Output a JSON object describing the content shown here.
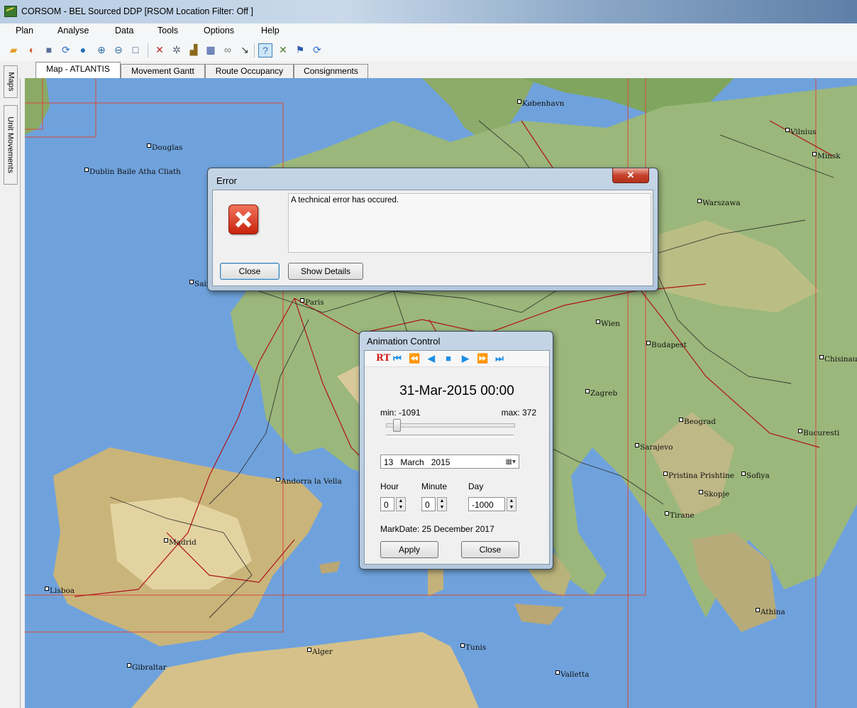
{
  "window": {
    "title": "CORSOM - BEL Sourced DDP [RSOM Location Filter: Off ]"
  },
  "menu": [
    "Plan",
    "Analyse",
    "Data",
    "Tools",
    "Options",
    "Help"
  ],
  "toolbar_icons": [
    "open-folder-icon",
    "refresh-layers-icon",
    "save-icon",
    "sync-icon",
    "globe-icon",
    "zoom-in-icon",
    "zoom-out-icon",
    "select-rectangle-icon",
    "route-icon",
    "search-network-icon",
    "depot-icon",
    "network-icon",
    "link-icon",
    "draw-line-icon",
    "identify-icon",
    "tools-icon",
    "flag-icon",
    "refresh-icon"
  ],
  "side_tabs": [
    "Maps",
    "Unit Movements"
  ],
  "tabs": [
    "Map - ATLANTIS",
    "Movement Gantt",
    "Route Occupancy",
    "Consignments"
  ],
  "map": {
    "cities": [
      "København",
      "Douglas",
      "Dublin Baile Atha Cliath",
      "Vilnius",
      "Minsk",
      "Warszawa",
      "Paris",
      "Wien",
      "Budapest",
      "Chisinau",
      "Zagreb",
      "Beograd",
      "Bucuresti",
      "Sarajevo",
      "Pristina Prishtine",
      "Sofiya",
      "Skopje",
      "Tirane",
      "Andorra la Vella",
      "Madrid",
      "Lisboa",
      "Gibraltar",
      "Alger",
      "Tunis",
      "Valletta",
      "Athina",
      "Sain"
    ]
  },
  "error_dialog": {
    "title": "Error",
    "close_glyph": "✕",
    "message": "A technical error has occured.",
    "close_label": "Close",
    "details_label": "Show Details"
  },
  "animation_control": {
    "title": "Animation Control",
    "rt_label": "RT",
    "datetime": "31-Mar-2015 00:00",
    "min_label": "min: -1091",
    "max_label": "max: 372",
    "slider_value": 0.05,
    "date_day": "13",
    "date_month": "March",
    "date_year": "2015",
    "hour_label": "Hour",
    "minute_label": "Minute",
    "day_label": "Day",
    "hour_value": "0",
    "minute_value": "0",
    "day_value": "-1000",
    "markdate": "MarkDate: 25 December 2017",
    "apply_label": "Apply",
    "close_label": "Close"
  }
}
